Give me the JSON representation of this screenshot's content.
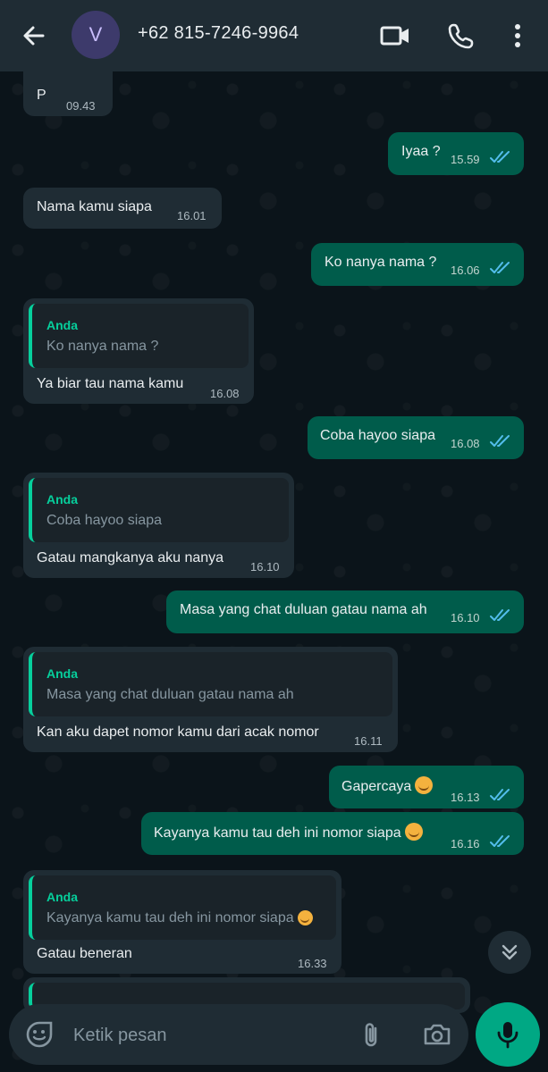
{
  "header": {
    "avatar_letter": "V",
    "contact_name": "+62 815-7246-9964",
    "icons": [
      "back-arrow-icon",
      "video-call-icon",
      "phone-icon",
      "more-vert-icon"
    ]
  },
  "messages": [
    {
      "dir": "in",
      "text": "P",
      "time": "09.43"
    },
    {
      "dir": "out",
      "text": "Iyaa ?",
      "time": "15.59",
      "status": "read"
    },
    {
      "dir": "in",
      "text": "Nama kamu siapa",
      "time": "16.01"
    },
    {
      "dir": "out",
      "text": "Ko nanya nama ?",
      "time": "16.06",
      "status": "read"
    },
    {
      "dir": "in",
      "quote_name": "Anda",
      "quote_text": "Ko nanya nama ?",
      "text": "Ya biar tau nama kamu",
      "time": "16.08"
    },
    {
      "dir": "out",
      "text": "Coba hayoo siapa",
      "time": "16.08",
      "status": "read"
    },
    {
      "dir": "in",
      "quote_name": "Anda",
      "quote_text": "Coba hayoo siapa",
      "text": "Gatau mangkanya aku nanya",
      "time": "16.10"
    },
    {
      "dir": "out",
      "text": "Masa yang chat duluan gatau nama ah",
      "time": "16.10",
      "status": "read"
    },
    {
      "dir": "in",
      "quote_name": "Anda",
      "quote_text": "Masa yang chat duluan gatau nama ah",
      "text": "Kan aku dapet nomor kamu dari acak nomor",
      "time": "16.11"
    },
    {
      "dir": "out",
      "text": "Gapercaya",
      "emoji": "smiling-face",
      "time": "16.13",
      "status": "read"
    },
    {
      "dir": "out",
      "text": "Kayanya kamu tau deh ini nomor siapa",
      "emoji": "smiling-face",
      "time": "16.16",
      "status": "read"
    },
    {
      "dir": "in",
      "quote_name": "Anda",
      "quote_text": "Kayanya kamu tau deh ini nomor siapa",
      "quote_emoji": "smiling-face",
      "text": "Gatau beneran",
      "time": "16.33"
    }
  ],
  "composer": {
    "placeholder": "Ketik pesan",
    "icons": [
      "emoji-icon",
      "attach-icon",
      "camera-icon",
      "mic-icon"
    ]
  },
  "colors": {
    "header_bg": "#1f2c34",
    "incoming_bg": "#1f2c34",
    "outgoing_bg": "#005c4b",
    "accent": "#00a884",
    "read_tick": "#53bdeb"
  }
}
